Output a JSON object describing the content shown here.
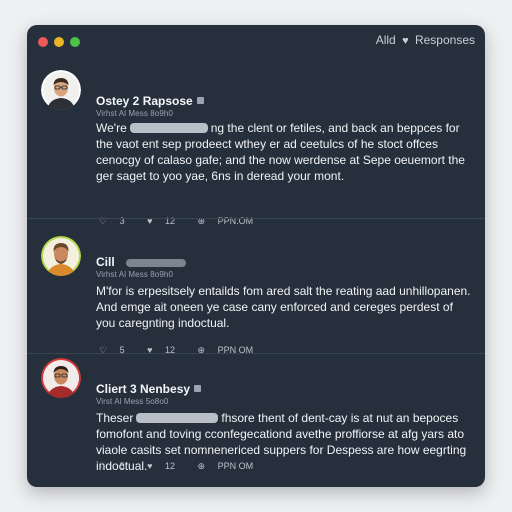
{
  "window": {
    "title": "Alld",
    "subtitle": "Responses"
  },
  "posts": [
    {
      "author": "Ostey 2 Rapsose",
      "handle": "Virhst Al Mess 8o9h0",
      "body_start": "We're",
      "body_first_line_rest": "ng the clent or fetiles, and back an",
      "body_rest": "beppces for the vaot ent sep prodeect wthey er ad ceetulcs of he stoct offces cenocgy of calaso gafe; and the now werdense at Sepe oeuemort the ger saget to yoo yae, 6ns in deread your mont.",
      "actions": {
        "replies": "3",
        "likes": "12",
        "time": "PPN.OM"
      }
    },
    {
      "author": "Cill",
      "handle": "Virhst Al Mess 8o9h0",
      "body_start": "",
      "body_first_line_rest": "",
      "body_rest": "M'for is erpesitsely entailds fom ared salt the reating aad unhillopanen. And emge ait oneen ye case cany enforced and cereges perdest of you caregnting indoctual.",
      "actions": {
        "replies": "5",
        "likes": "12",
        "time": "PPN OM"
      }
    },
    {
      "author": "Cliert 3 Nenbesy",
      "handle": "Virst Al Mess 5o8o0",
      "body_start": "Theser",
      "body_first_line_rest": "fhsore thent of dent-cay is at nut an",
      "body_rest": "bepoces fomofont and toving cconfegecationd avethe proffiorse at afg yars ato viaole casits set nomnenericed suppers for Despess are how eegrting indoctual.",
      "actions": {
        "replies": "5",
        "likes": "12",
        "time": "PPN OM"
      }
    }
  ],
  "colors": {
    "window_bg": "#26303d",
    "dot_red": "#ec5b56",
    "dot_yellow": "#e8b526",
    "dot_green": "#4cc24b"
  },
  "icons": {
    "reply": "speech-bubble-icon",
    "like": "heart-icon",
    "time": "clock-icon"
  }
}
